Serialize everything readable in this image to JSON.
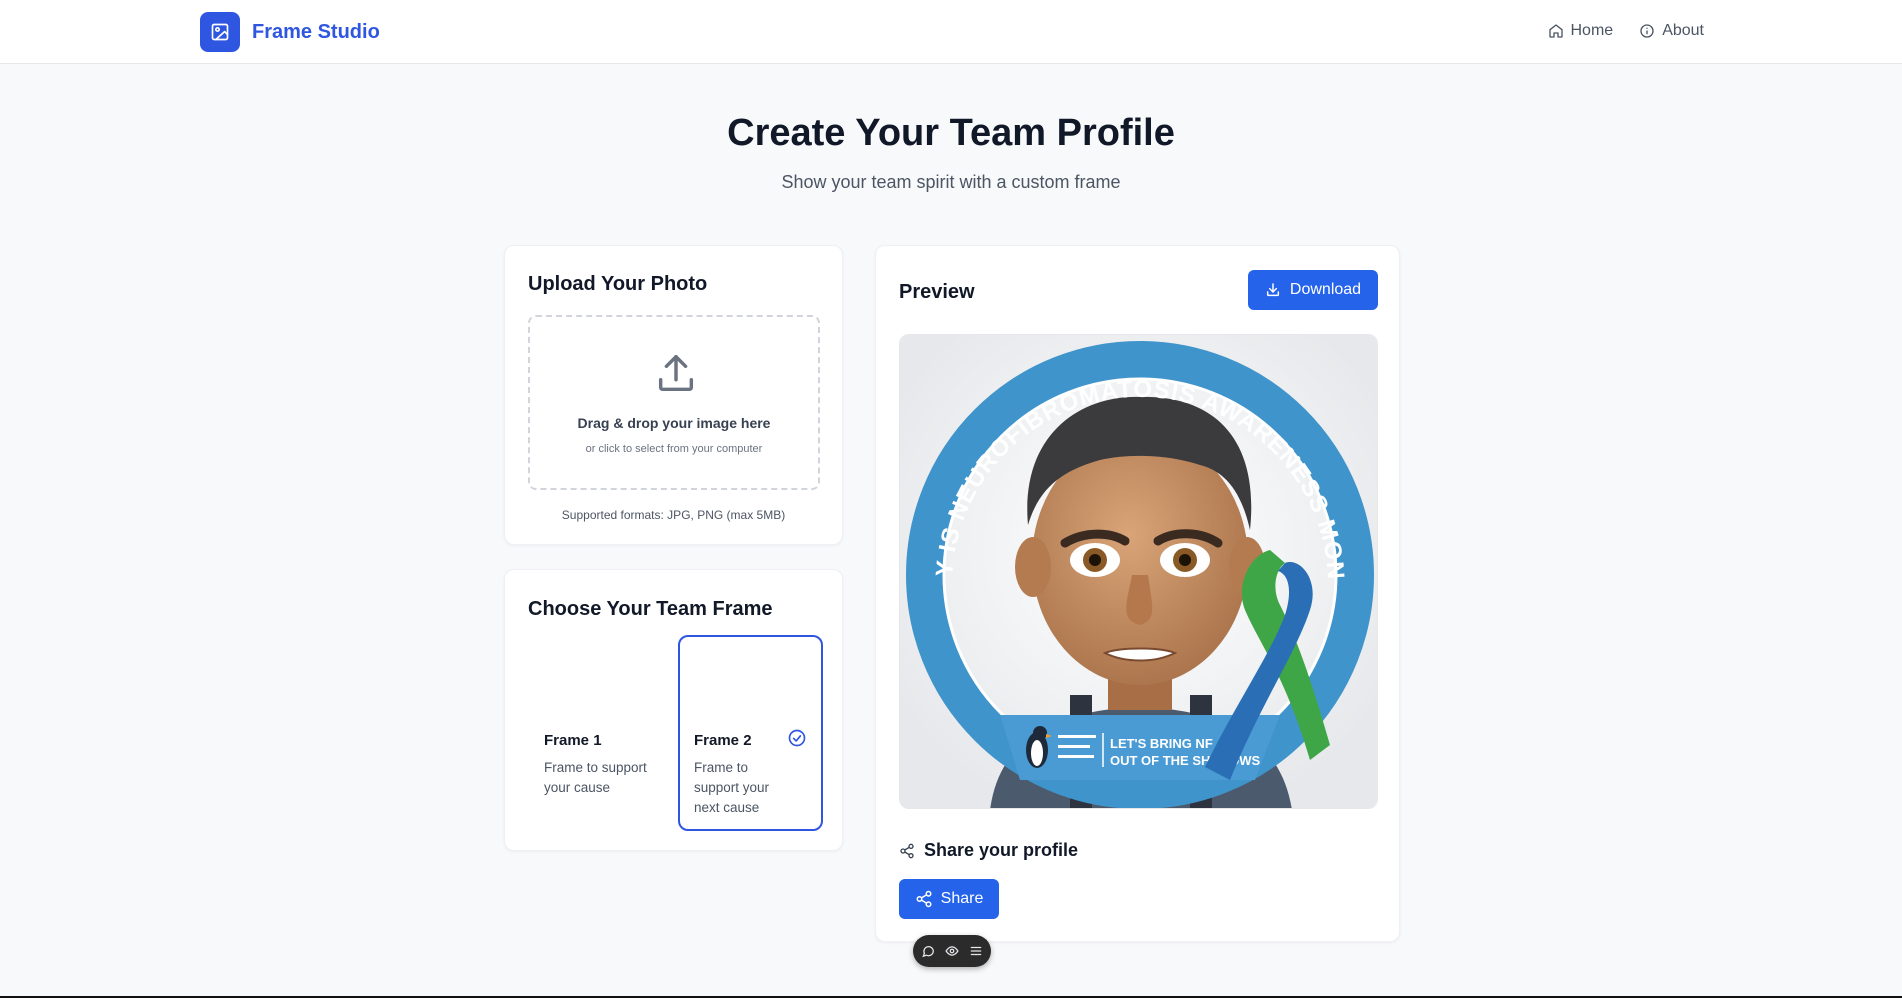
{
  "nav": {
    "brand": "Frame Studio",
    "brand_icon": "image-icon",
    "links": [
      {
        "label": "Home",
        "icon": "home-icon"
      },
      {
        "label": "About",
        "icon": "info-icon"
      }
    ]
  },
  "hero": {
    "title": "Create Your Team Profile",
    "subtitle": "Show your team spirit with a custom frame"
  },
  "upload": {
    "title": "Upload Your Photo",
    "drop_main": "Drag & drop your image here",
    "drop_sub": "or click to select from your computer",
    "formats": "Supported formats: JPG, PNG (max 5MB)"
  },
  "frames": {
    "title": "Choose Your Team Frame",
    "options": [
      {
        "name": "Frame 1",
        "desc": "Frame to support your cause",
        "selected": false
      },
      {
        "name": "Frame 2",
        "desc": "Frame to support your next cause",
        "selected": true
      }
    ]
  },
  "preview": {
    "title": "Preview",
    "download_label": "Download",
    "ring_text": "MAY IS NEUROFIBROMATOSIS AWARENESS MONTH",
    "banner_line1": "LET'S BRING NF",
    "banner_line2": "OUT OF THE SHADOWS",
    "share_heading": "Share your profile",
    "share_label": "Share"
  },
  "colors": {
    "brand": "#2f56e0",
    "button": "#2563eb",
    "ring": "#3f94cc",
    "ribbon_blue": "#2a6fb5",
    "ribbon_green": "#3fa648"
  }
}
